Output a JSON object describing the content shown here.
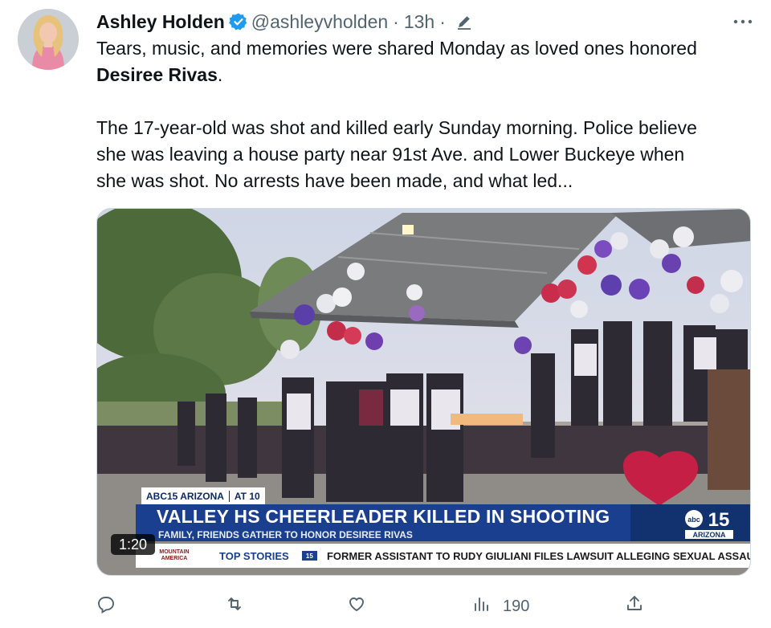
{
  "author": {
    "name": "Ashley Holden",
    "handle": "@ashleyvholden",
    "separator": "·",
    "time": "13h",
    "time_separator": "·"
  },
  "icons": {
    "verified": "verified-badge-icon",
    "edited": "edit-pencil-icon",
    "more": "more-dots-icon",
    "reply": "reply-icon",
    "retweet": "retweet-icon",
    "like": "heart-icon",
    "views": "views-bar-chart-icon",
    "share": "share-icon"
  },
  "colors": {
    "accent": "#1d9bf0",
    "muted": "#536471",
    "banner": "#1a3f8f"
  },
  "tweet": {
    "line1": "Tears, music, and memories were shared Monday as loved ones honored",
    "name_bold": "Desiree Rivas",
    "name_after": ".",
    "p2_line1": "The 17-year-old was shot and killed early Sunday morning. Police believe",
    "p2_line2": "she was leaving a house party near 91st Ave. and Lower Buckeye when",
    "p2_line3": "she was shot. No arrests have been made, and what led..."
  },
  "video": {
    "duration": "1:20",
    "station_tag": "ABC15 ARIZONA",
    "time_tag": "AT 10",
    "headline": "VALLEY HS CHEERLEADER KILLED IN SHOOTING",
    "subheadline": "FAMILY, FRIENDS GATHER TO HONOR DESIREE RIVAS",
    "logo_channel": "15",
    "logo_region": "ARIZONA",
    "sponsor_top": "MOUNTAIN",
    "sponsor_bottom": "AMERICA",
    "ticker_label": "TOP STORIES",
    "ticker_text": "FORMER ASSISTANT TO RUDY GIULIANI FILES LAWSUIT ALLEGING SEXUAL ASSAU"
  },
  "metrics": {
    "views": "190"
  }
}
